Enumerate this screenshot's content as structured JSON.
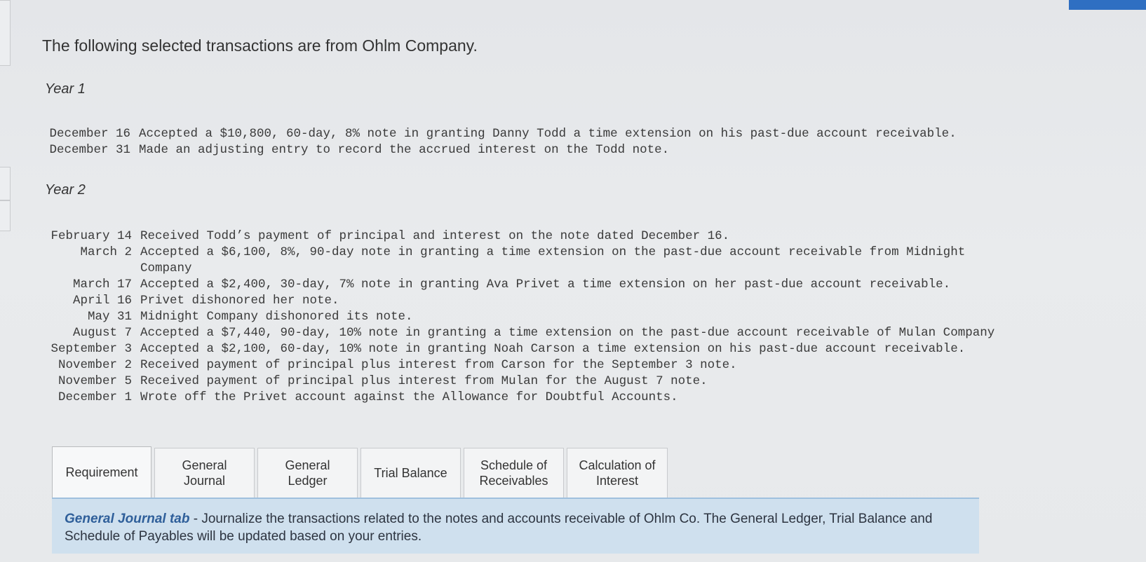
{
  "intro": "The following selected transactions are from Ohlm Company.",
  "year1": {
    "label": "Year 1",
    "transactions": [
      {
        "date": "December 16",
        "text": "Accepted a $10,800, 60-day, 8% note in granting Danny Todd a time extension on his past-due account receivable."
      },
      {
        "date": "December 31",
        "text": "Made an adjusting entry to record the accrued interest on the Todd note."
      }
    ]
  },
  "year2": {
    "label": "Year 2",
    "transactions": [
      {
        "date": "February 14",
        "text": "Received Todd’s payment of principal and interest on the note dated December 16."
      },
      {
        "date": "March 2",
        "text": "Accepted a $6,100, 8%, 90-day note in granting a time extension on the past-due account receivable from Midnight\nCompany"
      },
      {
        "date": "March 17",
        "text": "Accepted a $2,400, 30-day, 7% note in granting Ava Privet a time extension on her past-due account receivable."
      },
      {
        "date": "April 16",
        "text": "Privet dishonored her note."
      },
      {
        "date": "May 31",
        "text": "Midnight Company dishonored its note."
      },
      {
        "date": "August 7",
        "text": "Accepted a $7,440, 90-day, 10% note in granting a time extension on the past-due account receivable of Mulan Company"
      },
      {
        "date": "September 3",
        "text": "Accepted a $2,100, 60-day, 10% note in granting Noah Carson a time extension on his past-due account receivable."
      },
      {
        "date": "November 2",
        "text": "Received payment of principal plus interest from Carson for the September 3 note."
      },
      {
        "date": "November 5",
        "text": "Received payment of principal plus interest from Mulan for the August 7 note."
      },
      {
        "date": "December 1",
        "text": "Wrote off the Privet account against the Allowance for Doubtful Accounts."
      }
    ]
  },
  "tabs": [
    {
      "label": "Requirement"
    },
    {
      "label": "General\nJournal"
    },
    {
      "label": "General\nLedger"
    },
    {
      "label": "Trial Balance"
    },
    {
      "label": "Schedule of\nReceivables"
    },
    {
      "label": "Calculation of\nInterest"
    }
  ],
  "info": {
    "lead": "General Journal tab",
    "text": " - Journalize the transactions related to the notes and accounts receivable of Ohlm Co. The General Ledger, Trial Balance and Schedule of Payables will be updated based on your entries."
  },
  "colors": {
    "accent": "#2f6fc2",
    "panel_bg": "#cfe0ee",
    "panel_lead": "#2f5f9a"
  }
}
